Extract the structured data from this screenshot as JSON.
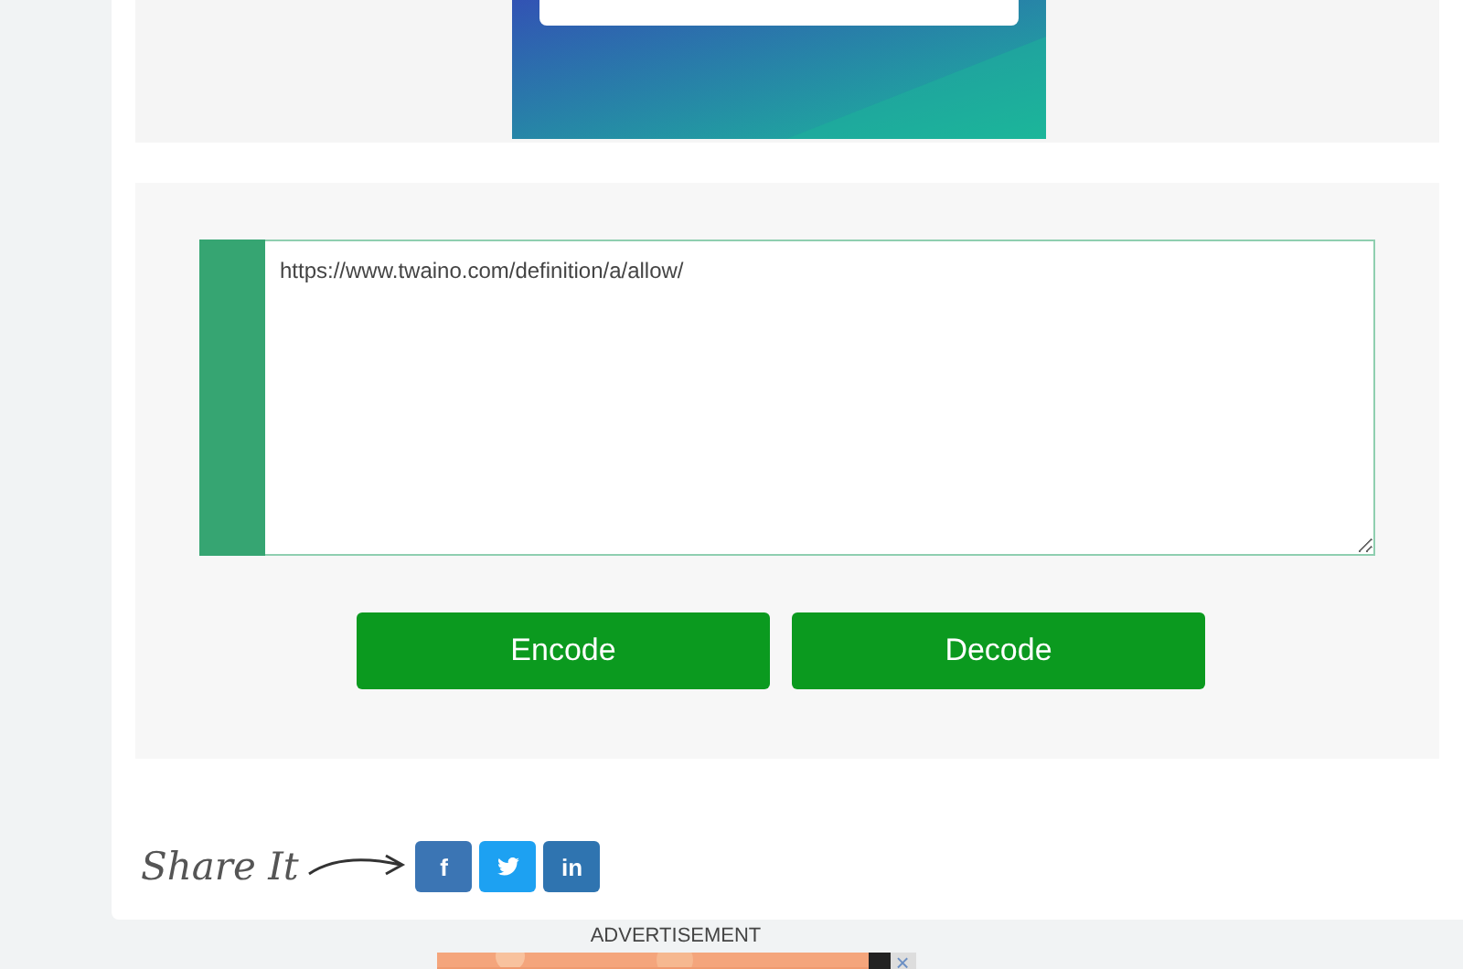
{
  "converter": {
    "input_value": "https://www.twaino.com/definition/a/allow/",
    "buttons": [
      "Encode",
      "Decode"
    ]
  },
  "share": {
    "label": "Share It",
    "buttons": [
      {
        "kind": "facebook",
        "glyph": "f"
      },
      {
        "kind": "twitter"
      },
      {
        "kind": "linkedin",
        "glyph": "in"
      }
    ]
  },
  "advertisement": {
    "label": "ADVERTISEMENT",
    "close": "×"
  }
}
